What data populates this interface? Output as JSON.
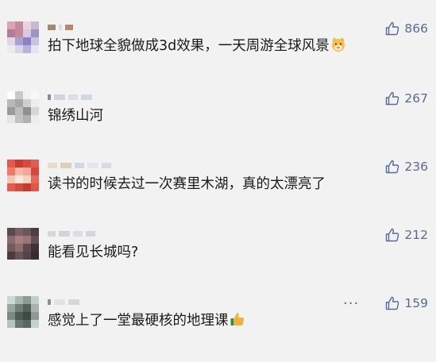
{
  "colors": {
    "accent": "#576b95",
    "background": "#f2f2f2",
    "text": "#1a1a1a"
  },
  "comments": [
    {
      "text": "拍下地球全貌做成3d效果，一天周游全球风景",
      "likes": "866",
      "emoji": "cat-face-icon"
    },
    {
      "text": "锦绣山河",
      "likes": "267"
    },
    {
      "text": "读书的时候去过一次赛里木湖，真的太漂亮了",
      "likes": "236"
    },
    {
      "text": "能看见长城吗?",
      "likes": "212"
    },
    {
      "text": "感觉上了一堂最硬核的地理课",
      "likes": "159",
      "emoji": "thumbs-up-icon",
      "more": "···"
    }
  ]
}
